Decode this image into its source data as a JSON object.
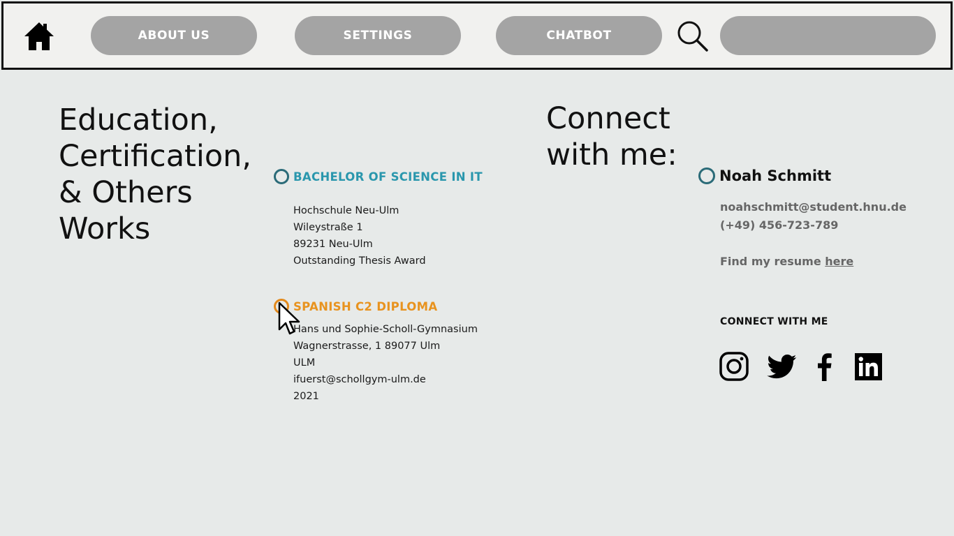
{
  "nav": {
    "about_label": "ABOUT US",
    "settings_label": "SETTINGS",
    "chatbot_label": "CHATBOT",
    "search_value": "",
    "search_placeholder": "",
    "home_icon": "home-icon",
    "search_icon": "search-icon",
    "pill_color": "#a4a4a4"
  },
  "education": {
    "heading": "Education,\nCertification,\n& Others\nWorks",
    "entries": [
      {
        "title": "BACHELOR OF SCIENCE IN IT",
        "title_color": "#2a97ad",
        "lines": [
          "Hochschule Neu-Ulm",
          "Wileystraße 1",
          "89231 Neu-Ulm",
          "Outstanding Thesis Award"
        ]
      },
      {
        "title": "SPANISH C2 DIPLOMA",
        "title_color": "#e8931f",
        "lines": [
          "Hans und Sophie-Scholl-Gymnasium",
          "Wagnerstrasse, 1 89077 Ulm",
          "ULM",
          "ifuerst@schollgym-ulm.de",
          "2021"
        ]
      }
    ]
  },
  "connect": {
    "heading": "Connect\nwith me:",
    "name": "Noah Schmitt",
    "email": "noahschmitt@student.hnu.de",
    "phone": "(+49) 456-723-789",
    "resume_prefix": "Find my resume ",
    "resume_link": "here",
    "small_heading": "CONNECT WITH ME",
    "socials": [
      "instagram-icon",
      "twitter-icon",
      "facebook-icon",
      "linkedin-icon"
    ]
  }
}
